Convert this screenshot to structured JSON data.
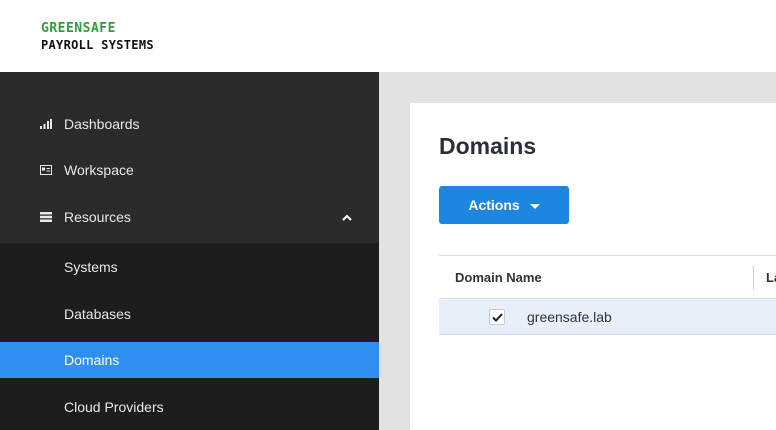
{
  "brand": {
    "line1": "GREENSAFE",
    "line2": "PAYROLL SYSTEMS"
  },
  "sidebar": {
    "items": [
      {
        "label": "Dashboards",
        "icon": "bar-chart-icon"
      },
      {
        "label": "Workspace",
        "icon": "card-icon"
      },
      {
        "label": "Resources",
        "icon": "list-icon",
        "expanded": true
      }
    ],
    "subitems": [
      {
        "label": "Systems"
      },
      {
        "label": "Databases"
      },
      {
        "label": "Domains",
        "active": true
      },
      {
        "label": "Cloud Providers"
      }
    ]
  },
  "main": {
    "title": "Domains",
    "actions_label": "Actions",
    "table": {
      "columns": [
        "Domain Name",
        "La"
      ],
      "rows": [
        {
          "checked": true,
          "domain": "greensafe.lab"
        }
      ]
    }
  },
  "colors": {
    "accent": "#2e8ff0",
    "sidebar_bg": "#2b2b2b",
    "brand_green": "#2f9e3a"
  }
}
